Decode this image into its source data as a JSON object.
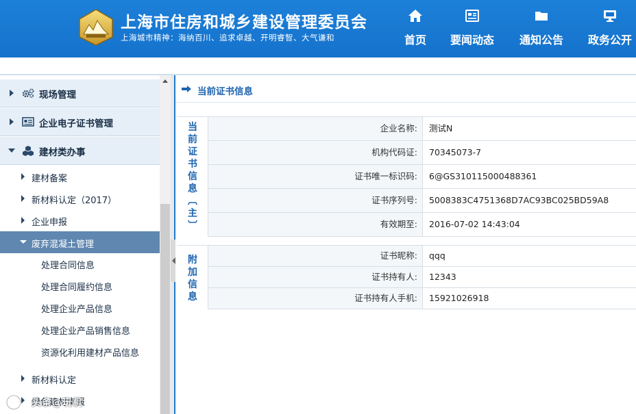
{
  "header": {
    "title": "上海市住房和城乡建设管理委员会",
    "motto": "上海城市精神：海纳百川、追求卓越、开明睿智、大气谦和",
    "nav": [
      {
        "label": "首页",
        "icon": "home-icon"
      },
      {
        "label": "要闻动态",
        "icon": "news-icon"
      },
      {
        "label": "通知公告",
        "icon": "folder-icon"
      },
      {
        "label": "政务公开",
        "icon": "monitor-icon"
      }
    ]
  },
  "sidebar": {
    "l1": [
      {
        "label": "现场管理",
        "icon": "gears-icon"
      },
      {
        "label": "企业电子证书管理",
        "icon": "certificate-icon"
      },
      {
        "label": "建材类办事",
        "icon": "cubes-icon"
      }
    ],
    "l2": [
      {
        "label": "建材备案"
      },
      {
        "label": "新材料认定（2017）"
      },
      {
        "label": "企业申报"
      },
      {
        "label": "废弃混凝土管理"
      },
      {
        "label": "新材料认定"
      },
      {
        "label": "绿色建材申报"
      }
    ],
    "l3": [
      {
        "label": "处理合同信息"
      },
      {
        "label": "处理合同履约信息"
      },
      {
        "label": "处理企业产品信息"
      },
      {
        "label": "处理企业产品销售信息"
      },
      {
        "label": "资源化利用建材产品信息"
      }
    ]
  },
  "content": {
    "title": "当前证书信息",
    "section_main": {
      "label_chars": [
        "当",
        "前",
        "证",
        "书",
        "信",
        "息",
        "︹",
        "主",
        "︺"
      ],
      "rows": [
        {
          "label": "企业名称:",
          "value": "测试N"
        },
        {
          "label": "机构代码证:",
          "value": "70345073-7"
        },
        {
          "label": "证书唯一标识码:",
          "value": "6@GS310115000488361"
        },
        {
          "label": "证书序列号:",
          "value": "5008383C4751368D7AC93BC025BD59A8"
        },
        {
          "label": "有效期至:",
          "value": "2016-07-02 14:43:04"
        }
      ]
    },
    "section_extra": {
      "label_chars": [
        "附",
        "加",
        "信",
        "息"
      ],
      "rows": [
        {
          "label": "证书昵称:",
          "value": "qqq"
        },
        {
          "label": "证书持有人:",
          "value": "12343"
        },
        {
          "label": "证书持有人手机:",
          "value": "15921026918"
        }
      ]
    }
  },
  "watermark": {
    "text": "头条@玩机"
  },
  "colors": {
    "header_bg": "#1572cc",
    "active_menu": "#5f87b0",
    "accent_text": "#1e64b0",
    "menu_l1_bg": "#e6eff8"
  }
}
